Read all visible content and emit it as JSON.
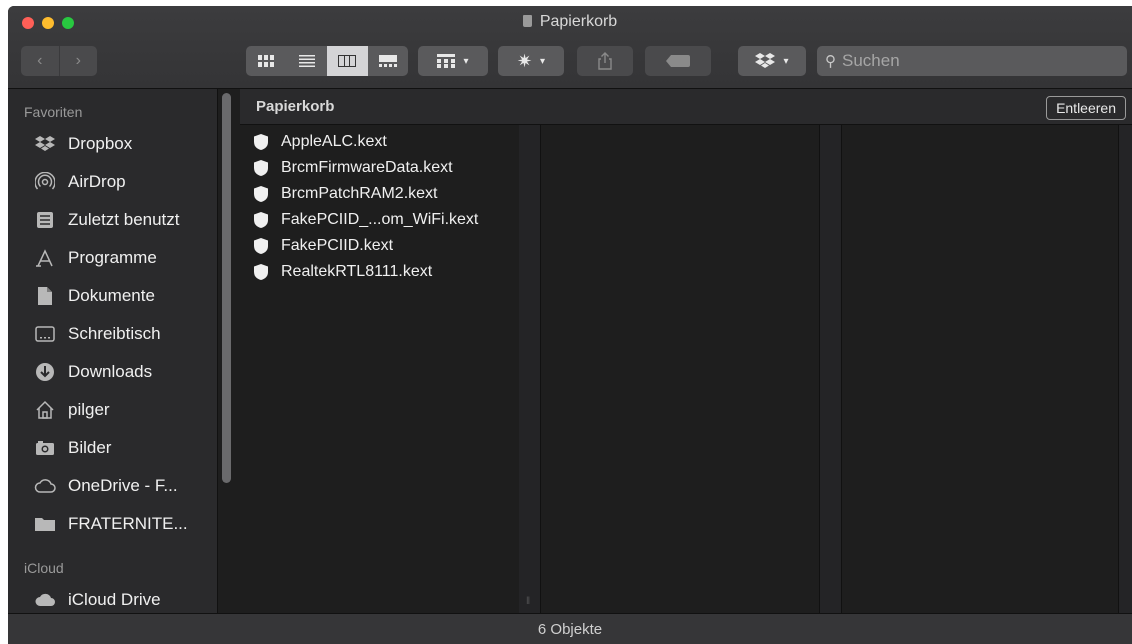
{
  "window": {
    "title": "Papierkorb"
  },
  "toolbar": {
    "back_icon": "chevron-left",
    "forward_icon": "chevron-right",
    "view_modes": [
      "icon-view",
      "list-view",
      "column-view",
      "gallery-view"
    ],
    "active_view": "column-view",
    "search_placeholder": "Suchen"
  },
  "sidebar": {
    "favorites_heading": "Favoriten",
    "favorites": [
      {
        "label": "Dropbox",
        "icon": "dropbox-icon"
      },
      {
        "label": "AirDrop",
        "icon": "airdrop-icon"
      },
      {
        "label": "Zuletzt benutzt",
        "icon": "recents-icon"
      },
      {
        "label": "Programme",
        "icon": "applications-icon"
      },
      {
        "label": "Dokumente",
        "icon": "documents-icon"
      },
      {
        "label": "Schreibtisch",
        "icon": "desktop-icon"
      },
      {
        "label": "Downloads",
        "icon": "downloads-icon"
      },
      {
        "label": "pilger",
        "icon": "home-icon"
      },
      {
        "label": "Bilder",
        "icon": "pictures-icon"
      },
      {
        "label": "OneDrive - F...",
        "icon": "cloud-icon"
      },
      {
        "label": "FRATERNITE...",
        "icon": "folder-icon"
      }
    ],
    "icloud_heading": "iCloud",
    "icloud": [
      {
        "label": "iCloud Drive",
        "icon": "icloud-icon"
      }
    ]
  },
  "path": {
    "label": "Papierkorb",
    "empty_button": "Entleeren"
  },
  "files": [
    "AppleALC.kext",
    "BrcmFirmwareData.kext",
    "BrcmPatchRAM2.kext",
    "FakePCIID_...om_WiFi.kext",
    "FakePCIID.kext",
    "RealtekRTL8111.kext"
  ],
  "status": {
    "count": "6 Objekte"
  },
  "colors": {
    "window_bg": "#1e1e1e",
    "sidebar_bg": "#2a2a2c",
    "accent_red": "#ff5f57",
    "accent_yellow": "#febc2e",
    "accent_green": "#28c840"
  }
}
